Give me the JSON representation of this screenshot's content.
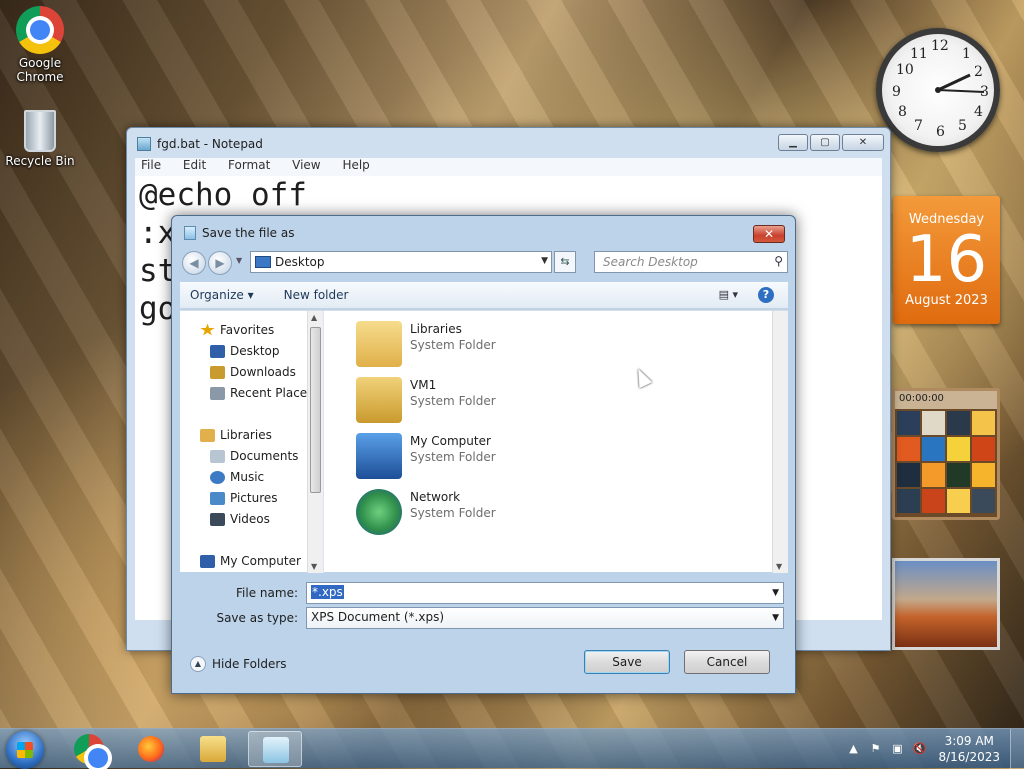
{
  "desktop": {
    "icons": [
      {
        "label": "Google\nChrome",
        "icon": "chrome-icon"
      },
      {
        "label": "Recycle Bin",
        "icon": "recycle-bin-icon"
      }
    ]
  },
  "gadgets": {
    "clock": {
      "numbers": [
        "12",
        "1",
        "2",
        "3",
        "4",
        "5",
        "6",
        "7",
        "8",
        "9",
        "10",
        "11"
      ]
    },
    "calendar": {
      "weekday": "Wednesday",
      "day": "16",
      "month_year": "August 2023"
    },
    "puzzle": {
      "timer": "00:00:00"
    }
  },
  "notepad": {
    "title": "fgd.bat - Notepad",
    "menu": [
      "File",
      "Edit",
      "Format",
      "View",
      "Help"
    ],
    "lines": [
      "@echo off",
      ":x",
      "st",
      "go"
    ],
    "controls": {
      "minimize": "▁",
      "maximize": "▢",
      "close": "✕"
    }
  },
  "dialog": {
    "title": "Save the file as",
    "close": "✕",
    "address": "Desktop",
    "search_placeholder": "Search Desktop",
    "toolbar": {
      "organize": "Organize ▾",
      "new_folder": "New folder",
      "views": "▤ ▾",
      "help": "?"
    },
    "nav_items": [
      {
        "label": "Favorites",
        "icon": "star-icon",
        "color": "#e8a500"
      },
      {
        "label": "Desktop",
        "icon": "desktop-icon",
        "color": "#2f5fa8"
      },
      {
        "label": "Downloads",
        "icon": "downloads-icon",
        "color": "#c99a2e"
      },
      {
        "label": "Recent Places",
        "icon": "recent-places-icon",
        "color": "#8a99a8"
      },
      {
        "label": "Libraries",
        "icon": "libraries-icon",
        "color": "#e2b04a"
      },
      {
        "label": "Documents",
        "icon": "documents-icon",
        "color": "#b8c6d4"
      },
      {
        "label": "Music",
        "icon": "music-icon",
        "color": "#3c7bc4"
      },
      {
        "label": "Pictures",
        "icon": "pictures-icon",
        "color": "#4b8ac9"
      },
      {
        "label": "Videos",
        "icon": "videos-icon",
        "color": "#3a4a5a"
      },
      {
        "label": "My Computer",
        "icon": "my-computer-icon",
        "color": "#2f5fa8"
      }
    ],
    "files": [
      {
        "name": "Libraries",
        "type": "System Folder",
        "icon": "libraries-folder-icon",
        "color": "#e8c468"
      },
      {
        "name": "VM1",
        "type": "System Folder",
        "icon": "user-folder-icon",
        "color": "#d9b45a"
      },
      {
        "name": "My Computer",
        "type": "System Folder",
        "icon": "computer-icon",
        "color": "#2e6bc0"
      },
      {
        "name": "Network",
        "type": "System Folder",
        "icon": "network-icon",
        "color": "#2f8f4a"
      }
    ],
    "file_name_label": "File name:",
    "file_name_value": "*.xps",
    "save_type_label": "Save as type:",
    "save_type_value": "XPS Document (*.xps)",
    "hide_folders": "Hide Folders",
    "save": "Save",
    "cancel": "Cancel"
  },
  "taskbar": {
    "apps": [
      "chrome-icon",
      "firefox-icon",
      "explorer-icon",
      "notepad-icon"
    ],
    "time": "3:09 AM",
    "date": "8/16/2023"
  }
}
